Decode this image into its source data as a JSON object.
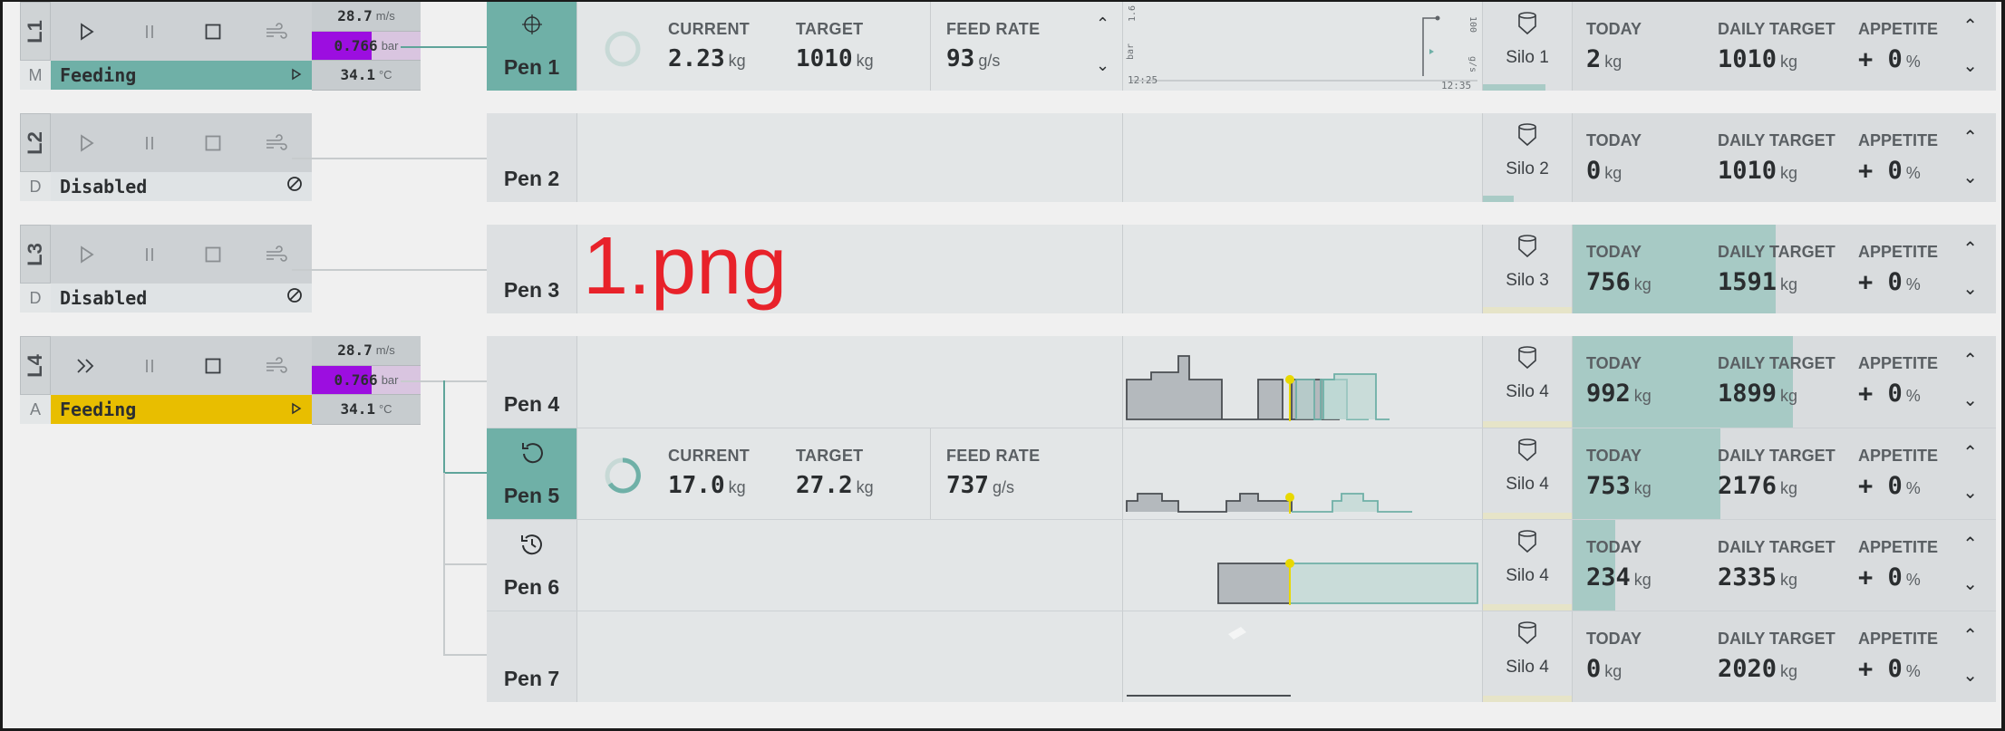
{
  "lines": [
    {
      "code": "L1",
      "mode": "M",
      "status": "Feeding",
      "status_icon": "play-small-icon",
      "wind": "28.7",
      "wind_unit": "m/s",
      "pressure": "0.766",
      "pressure_fill": 0.55,
      "pressure_unit": "bar",
      "temp": "34.1",
      "temp_unit": "°C",
      "color": "#6fb0a7"
    },
    {
      "code": "L2",
      "mode": "D",
      "status": "Disabled",
      "status_icon": "disabled-icon"
    },
    {
      "code": "L3",
      "mode": "D",
      "status": "Disabled",
      "status_icon": "disabled-icon"
    },
    {
      "code": "L4",
      "mode": "A",
      "status": "Feeding",
      "status_icon": "play-small-icon",
      "wind": "28.7",
      "wind_unit": "m/s",
      "pressure": "0.766",
      "pressure_fill": 0.55,
      "pressure_unit": "bar",
      "temp": "34.1",
      "temp_unit": "°C",
      "color": "#e8be00"
    }
  ],
  "labels": {
    "current": "CURRENT",
    "target": "TARGET",
    "feed_rate": "FEED RATE",
    "today": "TODAY",
    "daily_target": "DAILY TARGET",
    "appetite": "APPETITE",
    "kg": "kg",
    "gs": "g/s",
    "pct": "%"
  },
  "pens": [
    {
      "name": "Pen 1",
      "active": true,
      "icon": "crosshair-icon",
      "feeding": {
        "current": "2.23",
        "target": "1010",
        "rate": "93"
      },
      "silo": "Silo 1",
      "silo_level": 0.7,
      "today": "2",
      "daily_target": "1010",
      "appetite": "+ 0",
      "progress": 0.0
    },
    {
      "name": "Pen 2",
      "active": false,
      "silo": "Silo 2",
      "silo_level": 0.35,
      "today": "0",
      "daily_target": "1010",
      "appetite": "+ 0",
      "progress": 0.0
    },
    {
      "name": "Pen 3",
      "active": false,
      "silo": "Silo 3",
      "silo_level": 0.0,
      "today": "756",
      "daily_target": "1591",
      "appetite": "+ 0",
      "progress": 0.48
    },
    {
      "name": "Pen 4",
      "active": false,
      "silo": "Silo 4",
      "silo_level": 0.0,
      "today": "992",
      "daily_target": "1899",
      "appetite": "+ 0",
      "progress": 0.52
    },
    {
      "name": "Pen 5",
      "active": true,
      "icon": "restart-icon",
      "feeding": {
        "current": "17.0",
        "target": "27.2",
        "rate": "737"
      },
      "silo": "Silo 4",
      "silo_level": 0.0,
      "today": "753",
      "daily_target": "2176",
      "appetite": "+ 0",
      "progress": 0.35
    },
    {
      "name": "Pen 6",
      "active": false,
      "icon": "history-icon",
      "silo": "Silo 4",
      "silo_level": 0.0,
      "today": "234",
      "daily_target": "2335",
      "appetite": "+ 0",
      "progress": 0.1
    },
    {
      "name": "Pen 7",
      "active": false,
      "silo": "Silo 4",
      "silo_level": 0.0,
      "today": "0",
      "daily_target": "2020",
      "appetite": "+ 0",
      "progress": 0.0
    }
  ],
  "pen1_chart": {
    "time_start": "12:25",
    "time_end": "12:35",
    "left_axis": "bar",
    "left_top": "1.6",
    "left_bottom": "0",
    "right_axis": "g/s",
    "right_top": "100",
    "right_bottom": "0"
  },
  "watermark": "1.png",
  "colors": {
    "teal": "#6fb0a7",
    "yellow": "#e8be00",
    "purple": "#9c0ee0"
  }
}
